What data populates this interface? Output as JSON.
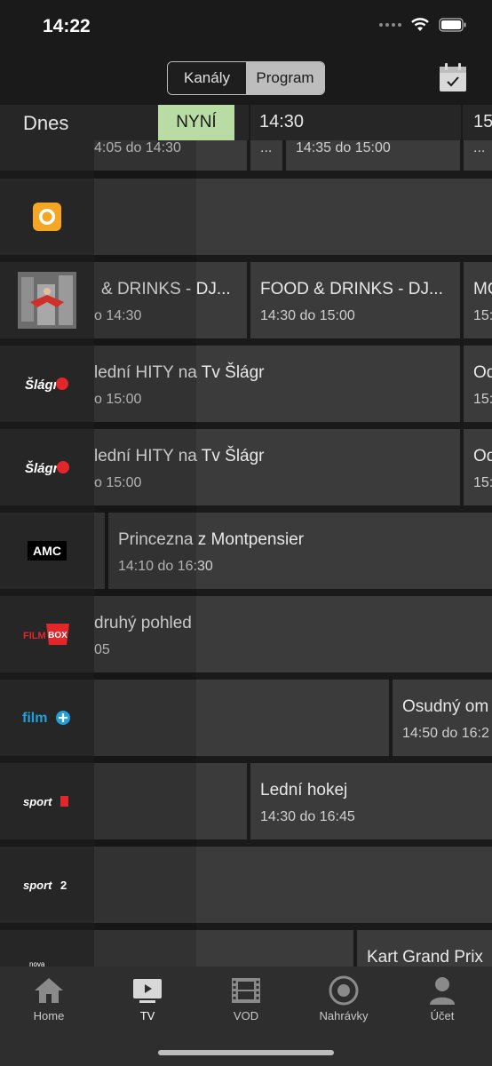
{
  "status": {
    "time": "14:22"
  },
  "header": {
    "segments": [
      "Kanály",
      "Program"
    ],
    "active_segment": 1
  },
  "timeline": {
    "day": "Dnes",
    "now": "NYNÍ",
    "ticks": [
      "14:30",
      "15"
    ]
  },
  "top_row": {
    "times": [
      "4:05 do 14:30",
      "...",
      "14:35 do 15:00",
      "..."
    ]
  },
  "channels": [
    {
      "logo": "orange-circle-logo",
      "programs": []
    },
    {
      "logo": "food-drinks-thumbnail",
      "programs": [
        {
          "title": "& DRINKS - DJ...",
          "time": "o 14:30"
        },
        {
          "title": "FOOD & DRINKS - DJ...",
          "time": "14:30 do 15:00"
        },
        {
          "title": "MO",
          "time": "15:"
        }
      ]
    },
    {
      "logo": "Šlágr TV",
      "programs": [
        {
          "title": "lední HITY na Tv Šlágr",
          "time": "o 15:00"
        },
        {
          "title": "Od",
          "time": "15:"
        }
      ]
    },
    {
      "logo": "Šlágr 2",
      "programs": [
        {
          "title": "lední HITY na Tv Šlágr",
          "time": "o 15:00"
        },
        {
          "title": "Od",
          "time": "15:"
        }
      ]
    },
    {
      "logo": "AMC",
      "programs": [
        {
          "title": "",
          "time": ""
        },
        {
          "title": "Princezna z Montpensier",
          "time": "14:10 do 16:30"
        }
      ]
    },
    {
      "logo": "FILMBOX",
      "programs": [
        {
          "title": "druhý pohled",
          "time": "05"
        }
      ]
    },
    {
      "logo": "film+",
      "programs": [
        {
          "title": "",
          "time": ""
        },
        {
          "title": "Osudný om",
          "time": "14:50 do 16:2"
        }
      ]
    },
    {
      "logo": "sport1",
      "programs": [
        {
          "title": "",
          "time": ""
        },
        {
          "title": "Lední hokej",
          "time": "14:30 do 16:45"
        }
      ]
    },
    {
      "logo": "sport2",
      "programs": []
    },
    {
      "logo": "nova sport",
      "programs": [
        {
          "title": "",
          "time": ""
        },
        {
          "title": "Kart Grand Prix",
          "time": ""
        }
      ]
    }
  ],
  "tabs": [
    {
      "label": "Home",
      "icon": "home-icon"
    },
    {
      "label": "TV",
      "icon": "tv-icon"
    },
    {
      "label": "VOD",
      "icon": "film-icon"
    },
    {
      "label": "Nahrávky",
      "icon": "record-icon"
    },
    {
      "label": "Účet",
      "icon": "user-icon"
    }
  ],
  "active_tab": 1,
  "colors": {
    "now_marker": "#b9dca5",
    "background": "#1a1a1a",
    "program_cell": "#3b3b3b"
  }
}
